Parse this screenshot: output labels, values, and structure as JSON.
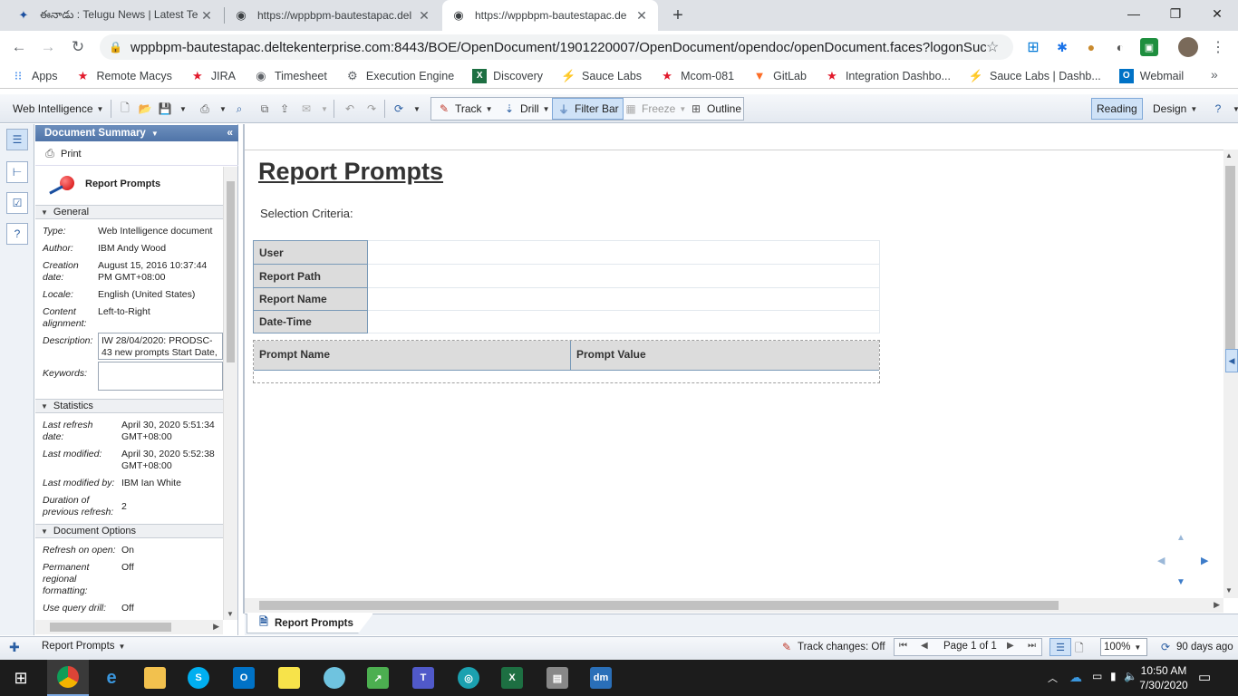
{
  "browser": {
    "tabs": [
      {
        "title": "ఈనాడు : Telugu News | Latest Te",
        "favicon": "eenadu-icon"
      },
      {
        "title": "https://wppbpm-bautestapac.del",
        "favicon": "globe-icon"
      },
      {
        "title": "https://wppbpm-bautestapac.de",
        "favicon": "globe-icon"
      }
    ],
    "new_tab": "+",
    "url": "wppbpm-bautestapac.deltekenterprise.com:8443/BOE/OpenDocument/1901220007/OpenDocument/opendoc/openDocument.faces?logonSuccessful...",
    "bookmarks": [
      {
        "label": "Apps",
        "icon": "apps-grid-icon",
        "color": "#1a73e8"
      },
      {
        "label": "Remote Macys",
        "icon": "star-icon",
        "color": "#e21a2c"
      },
      {
        "label": "JIRA",
        "icon": "star-icon",
        "color": "#e21a2c"
      },
      {
        "label": "Timesheet",
        "icon": "globe-icon",
        "color": "#5f6368"
      },
      {
        "label": "Execution Engine",
        "icon": "gear-icon",
        "color": "#5f6368"
      },
      {
        "label": "Discovery",
        "icon": "excel-icon",
        "color": "#1d6f42"
      },
      {
        "label": "Sauce Labs",
        "icon": "saucelabs-icon",
        "color": "#e2231a"
      },
      {
        "label": "Mcom-081",
        "icon": "star-icon",
        "color": "#e21a2c"
      },
      {
        "label": "GitLab",
        "icon": "gitlab-icon",
        "color": "#fc6d26"
      },
      {
        "label": "Integration Dashbo...",
        "icon": "star-icon",
        "color": "#e21a2c"
      },
      {
        "label": "Sauce Labs | Dashb...",
        "icon": "saucelabs-icon",
        "color": "#e2231a"
      },
      {
        "label": "Webmail",
        "icon": "outlook-icon",
        "color": "#0072c6"
      }
    ],
    "more_bookmarks": "»"
  },
  "webi_toolbar": {
    "app_menu": "Web Intelligence",
    "track": "Track",
    "drill": "Drill",
    "filter_bar": "Filter Bar",
    "freeze": "Freeze",
    "outline": "Outline",
    "reading": "Reading",
    "design": "Design"
  },
  "side_panel": {
    "header": "Document Summary",
    "print": "Print",
    "doc_title": "Report Prompts",
    "general": {
      "title": "General",
      "rows": [
        {
          "label": "Type:",
          "value": "Web Intelligence document"
        },
        {
          "label": "Author:",
          "value": "IBM Andy Wood"
        },
        {
          "label": "Creation date:",
          "value": "August 15, 2016 10:37:44 PM GMT+08:00"
        },
        {
          "label": "Locale:",
          "value": "English (United States)"
        },
        {
          "label": "Content alignment:",
          "value": "Left-to-Right"
        }
      ],
      "description_label": "Description:",
      "description": "IW 28/04/2020: PRODSC-43 new prompts Start Date, En",
      "keywords_label": "Keywords:"
    },
    "statistics": {
      "title": "Statistics",
      "rows": [
        {
          "label": "Last refresh date:",
          "value": "April 30, 2020 5:51:34 GMT+08:00"
        },
        {
          "label": "Last modified:",
          "value": "April 30, 2020 5:52:38 GMT+08:00"
        },
        {
          "label": "Last modified by:",
          "value": "IBM Ian White"
        },
        {
          "label": "Duration of previous refresh:",
          "value": "2"
        }
      ]
    },
    "options": {
      "title": "Document Options",
      "rows": [
        {
          "label": "Refresh on open:",
          "value": "On"
        },
        {
          "label": "Permanent regional formatting:",
          "value": "Off"
        },
        {
          "label": "Use query drill:",
          "value": "Off"
        }
      ]
    }
  },
  "report": {
    "title": "Report Prompts",
    "selection_criteria": "Selection Criteria:",
    "info_rows": [
      "User",
      "Report Path",
      "Report Name",
      "Date-Time"
    ],
    "prompt_headers": [
      "Prompt Name",
      "Prompt Value"
    ],
    "tab": "Report Prompts"
  },
  "status_bar": {
    "report_selector": "Report Prompts",
    "track_changes": "Track changes: Off",
    "page": "Page 1 of 1",
    "zoom": "100%",
    "refresh_age": "90 days ago"
  },
  "taskbar": {
    "time": "10:50 AM",
    "date": "7/30/2020"
  }
}
